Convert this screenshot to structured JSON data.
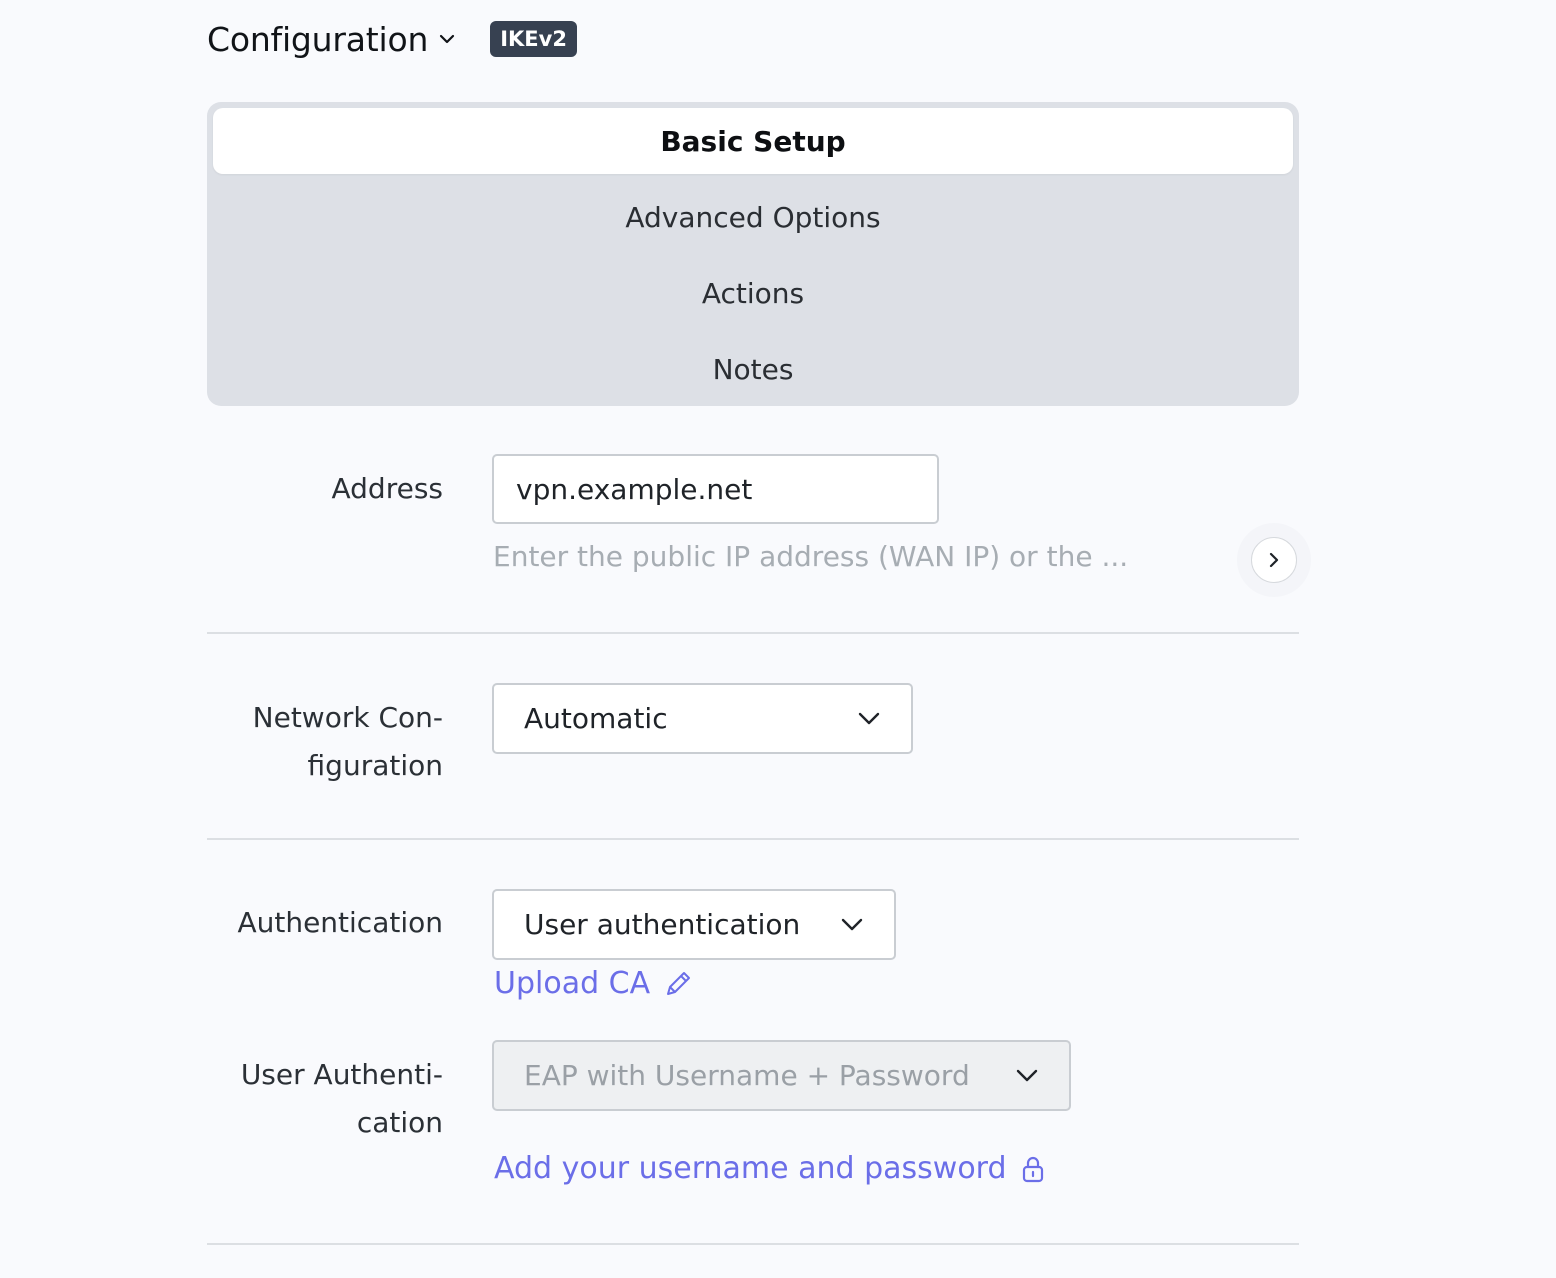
{
  "header": {
    "title": "Configuration",
    "badge": "IKEv2"
  },
  "tabs": [
    {
      "label": "Basic Setup",
      "active": true
    },
    {
      "label": "Advanced Options",
      "active": false
    },
    {
      "label": "Actions",
      "active": false
    },
    {
      "label": "Notes",
      "active": false
    }
  ],
  "address": {
    "label": "Address",
    "value": "vpn.example.net",
    "hint": "Enter the public IP address (WAN IP) or the ..."
  },
  "network": {
    "label_line1": "Network Con-",
    "label_line2": "figuration",
    "selected": "Automatic"
  },
  "authentication": {
    "label": "Authentication",
    "selected": "User authentication",
    "upload_link": "Upload CA"
  },
  "user_auth": {
    "label_line1": "User Authenti-",
    "label_line2": "cation",
    "selected": "EAP with Username + Password",
    "add_link": "Add your username and password"
  },
  "colors": {
    "accent": "#6b6ee8",
    "badge_bg": "#374151",
    "tab_bg": "#dde0e6"
  }
}
